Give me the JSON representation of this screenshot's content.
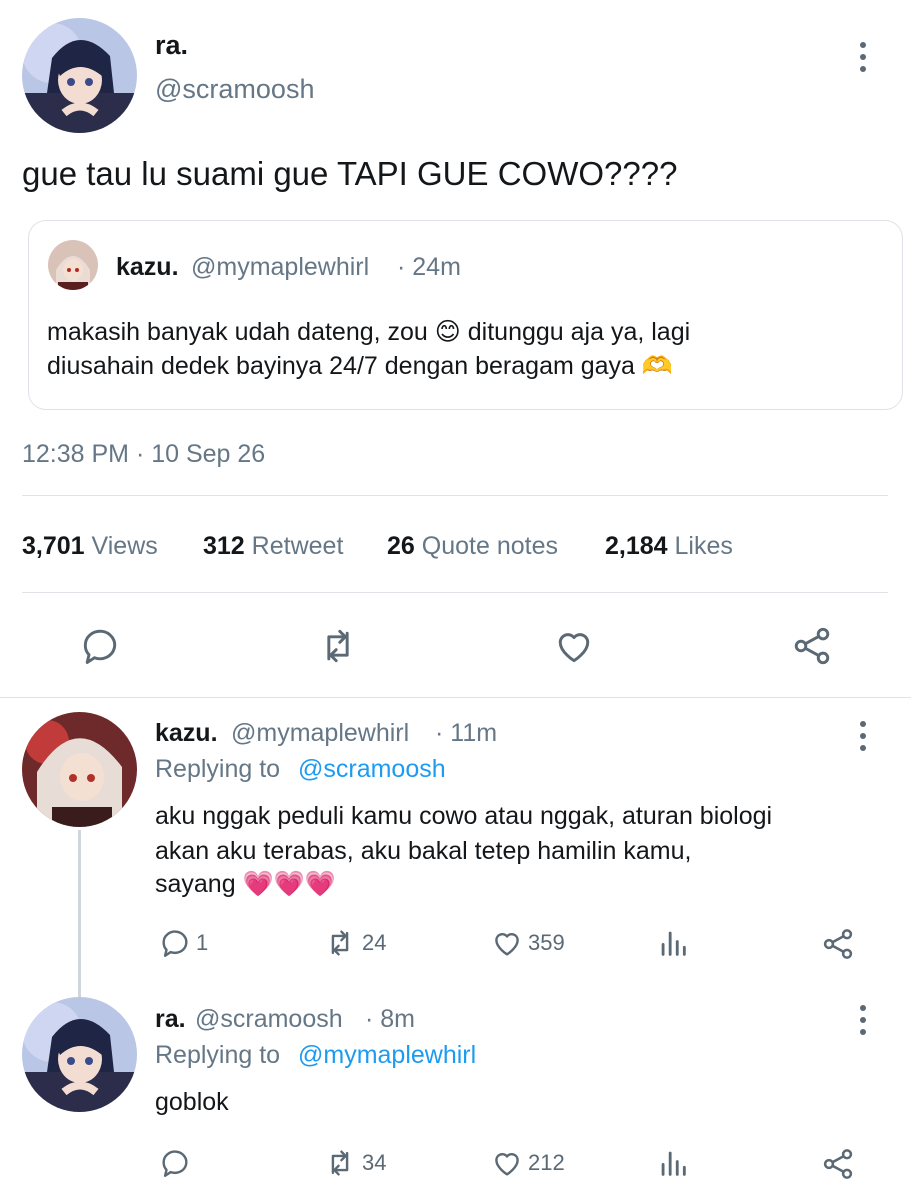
{
  "main_tweet": {
    "display_name": "ra.",
    "handle": "@scramoosh",
    "text": "gue tau lu suami gue TAPI GUE COWO????",
    "quoted": {
      "display_name": "kazu.",
      "handle": "@mymaplewhirl",
      "time": "· 24m",
      "text_line1": "makasih banyak udah dateng, zou 😊 ditunggu aja ya, lagi",
      "text_line2": "diusahain dedek bayinya 24/7 dengan beragam gaya 🫶"
    },
    "timestamp": "12:38 PM · 10 Sep 26",
    "stats": [
      {
        "value": "3,701",
        "label": "Views"
      },
      {
        "value": "312",
        "label": "Retweet"
      },
      {
        "value": "26",
        "label": "Quote notes"
      },
      {
        "value": "2,184",
        "label": "Likes"
      }
    ]
  },
  "replies": [
    {
      "display_name": "kazu.",
      "handle": "@mymaplewhirl",
      "time": "· 11m",
      "replying_prefix": "Replying to",
      "replying_to": "@scramoosh",
      "text_line1": "aku nggak peduli kamu cowo atau nggak, aturan biologi",
      "text_line2": "akan aku terabas, aku bakal tetep hamilin kamu,",
      "text_line3": "sayang 💗💗💗",
      "replies_count": "1",
      "retweets_count": "24",
      "likes_count": "359"
    },
    {
      "display_name": "ra.",
      "handle": "@scramoosh",
      "time": "· 8m",
      "replying_prefix": "Replying to",
      "replying_to": "@mymaplewhirl",
      "text_line1": "goblok",
      "replies_count": "",
      "retweets_count": "34",
      "likes_count": "212"
    }
  ],
  "colors": {
    "link": "#1d9bf0",
    "secondary_text": "#657786",
    "icon": "#5b6975",
    "divider": "#dfe3e8"
  }
}
